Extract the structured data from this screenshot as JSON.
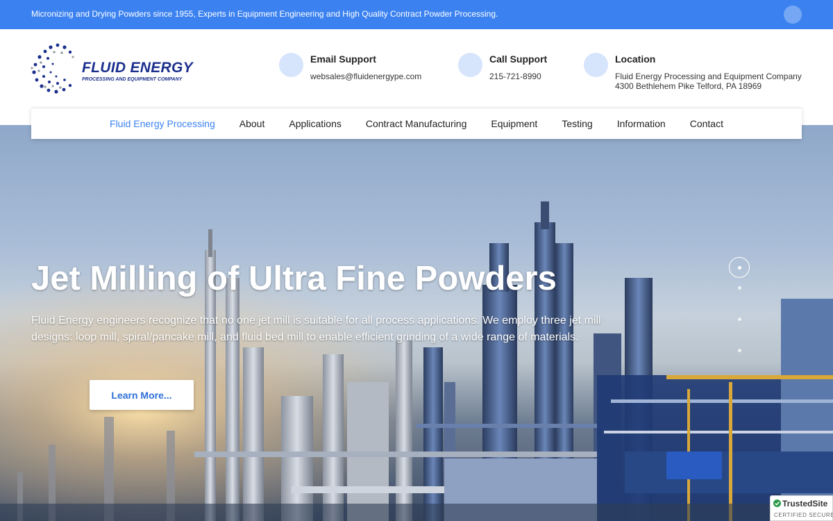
{
  "topbar": {
    "text": "Micronizing and Drying Powders since 1955, Experts in Equipment Engineering and High Quality Contract Powder Processing."
  },
  "logo": {
    "name": "FLUID ENERGY",
    "tagline": "PROCESSING AND EQUIPMENT COMPANY"
  },
  "contact": {
    "email": {
      "title": "Email Support",
      "value": "websales@fluidenergype.com",
      "icon": "email-icon"
    },
    "call": {
      "title": "Call Support",
      "value": "215-721-8990",
      "icon": "phone-icon"
    },
    "location": {
      "title": "Location",
      "line1": "Fluid Energy Processing and Equipment Company",
      "line2": "4300 Bethlehem Pike Telford, PA 18969",
      "icon": "location-icon"
    }
  },
  "nav": {
    "items": [
      {
        "label": "Fluid Energy Processing",
        "active": true
      },
      {
        "label": "About"
      },
      {
        "label": "Applications"
      },
      {
        "label": "Contract Manufacturing"
      },
      {
        "label": "Equipment"
      },
      {
        "label": "Testing"
      },
      {
        "label": "Information"
      },
      {
        "label": "Contact"
      }
    ]
  },
  "hero": {
    "title": "Jet Milling of Ultra Fine Powders",
    "text": "Fluid Energy engineers recognize that no one jet mill is suitable for all process applications. We employ three jet mill designs: loop mill, spiral/pancake mill, and fluid bed mill to enable efficient grinding of a wide range of materials.",
    "button": "Learn More...",
    "slides": {
      "count": 4,
      "active": 1
    }
  },
  "badge": {
    "name": "TrustedSite",
    "sub": "CERTIFIED SECURE"
  },
  "colors": {
    "accent": "#3b82f0",
    "logo": "#1b2f8c",
    "icon_bg": "#d6e4fc"
  }
}
